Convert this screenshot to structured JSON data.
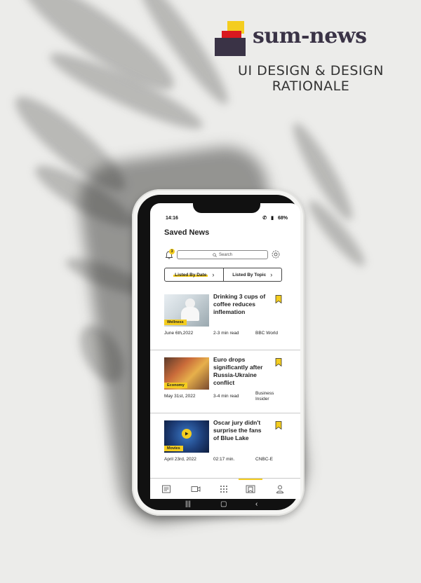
{
  "brand": {
    "name": "sum-news",
    "tagline": "UI DESIGN & DESIGN RATIONALE"
  },
  "status_bar": {
    "time": "14:16",
    "battery": "68%"
  },
  "page": {
    "title": "Saved News"
  },
  "search": {
    "placeholder": "Search",
    "notification_count": "3"
  },
  "filters": [
    {
      "label": "Listed By Date",
      "active": true
    },
    {
      "label": "Listed By Topic",
      "active": false
    }
  ],
  "news": [
    {
      "category": "Wellness",
      "headline": "Drinking 3 cups of coffee reduces inflemation",
      "date": "June 6th,2022",
      "read_time": "2-3 min read",
      "source": "BBC World"
    },
    {
      "category": "Economy",
      "headline": "Euro drops significantly after Russia-Ukraine conflict",
      "date": "May 31st, 2022",
      "read_time": "3-4 min read",
      "source": "Business Insider"
    },
    {
      "category": "Movies",
      "headline": "Oscar jury didn't surprise the fans of Blue Lake",
      "date": "April 23rd, 2022",
      "read_time": "02:17 min.",
      "source": "CNBC-E"
    }
  ],
  "bottom_nav": [
    {
      "icon": "news-icon"
    },
    {
      "icon": "video-icon"
    },
    {
      "icon": "grid-icon"
    },
    {
      "icon": "bookmark-icon",
      "active": true
    },
    {
      "icon": "profile-icon"
    }
  ],
  "colors": {
    "accent": "#f4cd1f",
    "brand_red": "#d9191f",
    "brand_dark": "#3a3346"
  }
}
